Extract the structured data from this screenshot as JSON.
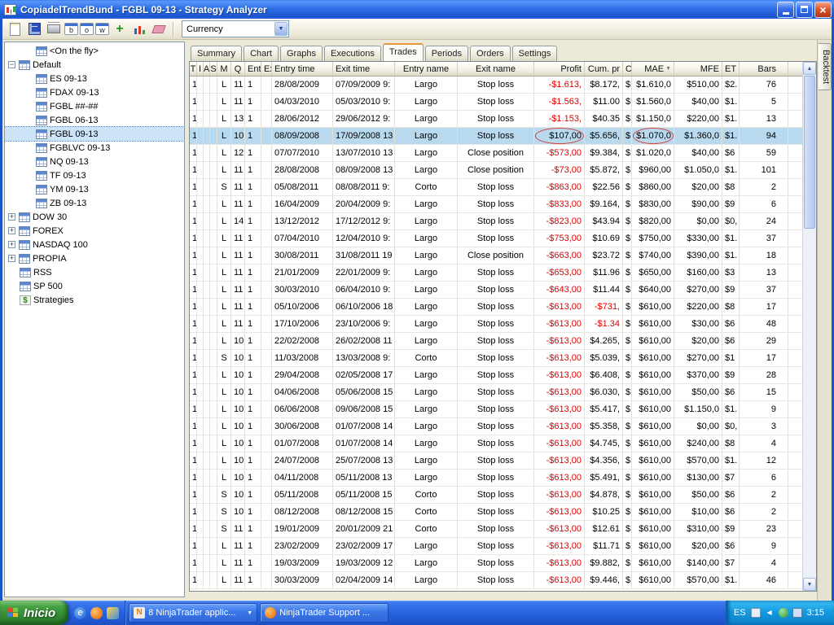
{
  "window": {
    "title": "CopiadelTrendBund - FGBL 09-13 - Strategy Analyzer"
  },
  "toolbar": {
    "combo": {
      "value": "Currency"
    },
    "buttons": [
      {
        "name": "new-document-icon"
      },
      {
        "name": "save-icon"
      },
      {
        "name": "print-icon"
      },
      {
        "name": "period-b-button",
        "label": "b"
      },
      {
        "name": "period-o-button",
        "label": "o"
      },
      {
        "name": "period-w-button",
        "label": "w"
      },
      {
        "name": "add-plus-button",
        "label": "+"
      },
      {
        "name": "chart-bars-icon"
      },
      {
        "name": "erase-icon"
      }
    ]
  },
  "sidebar": {
    "items": [
      {
        "label": "<On the fly>",
        "indent": 1,
        "icon": "grid"
      },
      {
        "label": "Default",
        "indent": 0,
        "expander": "minus",
        "icon": "grid"
      },
      {
        "label": "ES 09-13",
        "indent": 1,
        "icon": "grid"
      },
      {
        "label": "FDAX 09-13",
        "indent": 1,
        "icon": "grid"
      },
      {
        "label": "FGBL ##-##",
        "indent": 1,
        "icon": "grid"
      },
      {
        "label": "FGBL 06-13",
        "indent": 1,
        "icon": "grid"
      },
      {
        "label": "FGBL 09-13",
        "indent": 1,
        "icon": "grid",
        "selected": true
      },
      {
        "label": "FGBLVC 09-13",
        "indent": 1,
        "icon": "grid"
      },
      {
        "label": "NQ 09-13",
        "indent": 1,
        "icon": "grid"
      },
      {
        "label": "TF 09-13",
        "indent": 1,
        "icon": "grid"
      },
      {
        "label": "YM 09-13",
        "indent": 1,
        "icon": "grid"
      },
      {
        "label": "ZB 09-13",
        "indent": 1,
        "icon": "grid"
      },
      {
        "label": "DOW 30",
        "indent": 0,
        "expander": "plus",
        "icon": "grid"
      },
      {
        "label": "FOREX",
        "indent": 0,
        "expander": "plus",
        "icon": "grid"
      },
      {
        "label": "NASDAQ 100",
        "indent": 0,
        "expander": "plus",
        "icon": "grid"
      },
      {
        "label": "PROPIA",
        "indent": 0,
        "expander": "plus",
        "icon": "grid"
      },
      {
        "label": "RSS",
        "indent": 0,
        "icon": "grid"
      },
      {
        "label": "SP 500",
        "indent": 0,
        "icon": "grid"
      },
      {
        "label": "Strategies",
        "indent": 0,
        "icon": "dollar"
      }
    ]
  },
  "tabs": {
    "items": [
      "Summary",
      "Chart",
      "Graphs",
      "Executions",
      "Trades",
      "Periods",
      "Orders",
      "Settings"
    ],
    "active": "Trades"
  },
  "backtest_tab": {
    "label": "Backtest"
  },
  "trades": {
    "columns": [
      "T",
      "I",
      "A",
      "S",
      "M",
      "Q",
      "Ent",
      "Ex",
      "Entry time",
      "Exit time",
      "Entry name",
      "Exit name",
      "Profit",
      "Cum. pr",
      "C",
      "MAE",
      "MFE",
      "ET",
      "Bars"
    ],
    "sorted_by": "MAE",
    "sort_direction": "desc",
    "highlighted_row": 4,
    "annotations": {
      "circled_columns": [
        "Profit",
        "MAE"
      ],
      "circle_color": "#d04040"
    },
    "rows": [
      [
        "1",
        "",
        "",
        "",
        "L",
        "11",
        "1",
        "",
        "28/08/2009",
        "07/09/2009 9:",
        "Largo",
        "Stop loss",
        "-$1.613,",
        "$8.172,",
        "$",
        "$1.610,0",
        "$510,00",
        "$2.",
        "76"
      ],
      [
        "1",
        "",
        "",
        "",
        "L",
        "11",
        "1",
        "",
        "04/03/2010",
        "05/03/2010 9:",
        "Largo",
        "Stop loss",
        "-$1.563,",
        "$11.00",
        "$",
        "$1.560,0",
        "$40,00",
        "$1.",
        "5"
      ],
      [
        "1",
        "",
        "",
        "",
        "L",
        "13",
        "1",
        "",
        "28/06/2012",
        "29/06/2012 9:",
        "Largo",
        "Stop loss",
        "-$1.153,",
        "$40.35",
        "$",
        "$1.150,0",
        "$220,00",
        "$1.",
        "13"
      ],
      [
        "1",
        "",
        "",
        "",
        "L",
        "10",
        "1",
        "",
        "08/09/2008",
        "17/09/2008 13",
        "Largo",
        "Stop loss",
        "$107,00",
        "$5.656,",
        "$",
        "$1.070,0",
        "$1.360,0",
        "$1.",
        "94"
      ],
      [
        "1",
        "",
        "",
        "",
        "L",
        "12",
        "1",
        "",
        "07/07/2010",
        "13/07/2010 13",
        "Largo",
        "Close position",
        "-$573,00",
        "$9.384,",
        "$",
        "$1.020,0",
        "$40,00",
        "$6",
        "59"
      ],
      [
        "1",
        "",
        "",
        "",
        "L",
        "11",
        "1",
        "",
        "28/08/2008",
        "08/09/2008 13",
        "Largo",
        "Close position",
        "-$73,00",
        "$5.872,",
        "$",
        "$960,00",
        "$1.050,0",
        "$1.",
        "101"
      ],
      [
        "1",
        "",
        "",
        "",
        "S",
        "11",
        "1",
        "",
        "05/08/2011",
        "08/08/2011 9:",
        "Corto",
        "Stop loss",
        "-$863,00",
        "$22.56",
        "$",
        "$860,00",
        "$20,00",
        "$8",
        "2"
      ],
      [
        "1",
        "",
        "",
        "",
        "L",
        "11",
        "1",
        "",
        "16/04/2009",
        "20/04/2009 9:",
        "Largo",
        "Stop loss",
        "-$833,00",
        "$9.164,",
        "$",
        "$830,00",
        "$90,00",
        "$9",
        "6"
      ],
      [
        "1",
        "",
        "",
        "",
        "L",
        "14",
        "1",
        "",
        "13/12/2012",
        "17/12/2012 9:",
        "Largo",
        "Stop loss",
        "-$823,00",
        "$43.94",
        "$",
        "$820,00",
        "$0,00",
        "$0,",
        "24"
      ],
      [
        "1",
        "",
        "",
        "",
        "L",
        "11",
        "1",
        "",
        "07/04/2010",
        "12/04/2010 9:",
        "Largo",
        "Stop loss",
        "-$753,00",
        "$10.69",
        "$",
        "$750,00",
        "$330,00",
        "$1.",
        "37"
      ],
      [
        "1",
        "",
        "",
        "",
        "L",
        "11",
        "1",
        "",
        "30/08/2011",
        "31/08/2011 19",
        "Largo",
        "Close position",
        "-$663,00",
        "$23.72",
        "$",
        "$740,00",
        "$390,00",
        "$1.",
        "18"
      ],
      [
        "1",
        "",
        "",
        "",
        "L",
        "11",
        "1",
        "",
        "21/01/2009",
        "22/01/2009 9:",
        "Largo",
        "Stop loss",
        "-$653,00",
        "$11.96",
        "$",
        "$650,00",
        "$160,00",
        "$3",
        "13"
      ],
      [
        "1",
        "",
        "",
        "",
        "L",
        "11",
        "1",
        "",
        "30/03/2010",
        "06/04/2010 9:",
        "Largo",
        "Stop loss",
        "-$643,00",
        "$11.44",
        "$",
        "$640,00",
        "$270,00",
        "$9",
        "37"
      ],
      [
        "1",
        "",
        "",
        "",
        "L",
        "11",
        "1",
        "",
        "05/10/2006",
        "06/10/2006 18",
        "Largo",
        "Stop loss",
        "-$613,00",
        "-$731,",
        "$",
        "$610,00",
        "$220,00",
        "$8",
        "17"
      ],
      [
        "1",
        "",
        "",
        "",
        "L",
        "11",
        "1",
        "",
        "17/10/2006",
        "23/10/2006 9:",
        "Largo",
        "Stop loss",
        "-$613,00",
        "-$1.34",
        "$",
        "$610,00",
        "$30,00",
        "$6",
        "48"
      ],
      [
        "1",
        "",
        "",
        "",
        "L",
        "10",
        "1",
        "",
        "22/02/2008",
        "26/02/2008 11",
        "Largo",
        "Stop loss",
        "-$613,00",
        "$4.265,",
        "$",
        "$610,00",
        "$20,00",
        "$6",
        "29"
      ],
      [
        "1",
        "",
        "",
        "",
        "S",
        "10",
        "1",
        "",
        "11/03/2008",
        "13/03/2008 9:",
        "Corto",
        "Stop loss",
        "-$613,00",
        "$5.039,",
        "$",
        "$610,00",
        "$270,00",
        "$1",
        "17"
      ],
      [
        "1",
        "",
        "",
        "",
        "L",
        "10",
        "1",
        "",
        "29/04/2008",
        "02/05/2008 17",
        "Largo",
        "Stop loss",
        "-$613,00",
        "$6.408,",
        "$",
        "$610,00",
        "$370,00",
        "$9",
        "28"
      ],
      [
        "1",
        "",
        "",
        "",
        "L",
        "10",
        "1",
        "",
        "04/06/2008",
        "05/06/2008 15",
        "Largo",
        "Stop loss",
        "-$613,00",
        "$6.030,",
        "$",
        "$610,00",
        "$50,00",
        "$6",
        "15"
      ],
      [
        "1",
        "",
        "",
        "",
        "L",
        "10",
        "1",
        "",
        "06/06/2008",
        "09/06/2008 15",
        "Largo",
        "Stop loss",
        "-$613,00",
        "$5.417,",
        "$",
        "$610,00",
        "$1.150,0",
        "$1.",
        "9"
      ],
      [
        "1",
        "",
        "",
        "",
        "L",
        "10",
        "1",
        "",
        "30/06/2008",
        "01/07/2008 14",
        "Largo",
        "Stop loss",
        "-$613,00",
        "$5.358,",
        "$",
        "$610,00",
        "$0,00",
        "$0,",
        "3"
      ],
      [
        "1",
        "",
        "",
        "",
        "L",
        "10",
        "1",
        "",
        "01/07/2008",
        "01/07/2008 14",
        "Largo",
        "Stop loss",
        "-$613,00",
        "$4.745,",
        "$",
        "$610,00",
        "$240,00",
        "$8",
        "4"
      ],
      [
        "1",
        "",
        "",
        "",
        "L",
        "10",
        "1",
        "",
        "24/07/2008",
        "25/07/2008 13",
        "Largo",
        "Stop loss",
        "-$613,00",
        "$4.356,",
        "$",
        "$610,00",
        "$570,00",
        "$1.",
        "12"
      ],
      [
        "1",
        "",
        "",
        "",
        "L",
        "10",
        "1",
        "",
        "04/11/2008",
        "05/11/2008 13",
        "Largo",
        "Stop loss",
        "-$613,00",
        "$5.491,",
        "$",
        "$610,00",
        "$130,00",
        "$7",
        "6"
      ],
      [
        "1",
        "",
        "",
        "",
        "S",
        "10",
        "1",
        "",
        "05/11/2008",
        "05/11/2008 15",
        "Corto",
        "Stop loss",
        "-$613,00",
        "$4.878,",
        "$",
        "$610,00",
        "$50,00",
        "$6",
        "2"
      ],
      [
        "1",
        "",
        "",
        "",
        "S",
        "10",
        "1",
        "",
        "08/12/2008",
        "08/12/2008 15",
        "Corto",
        "Stop loss",
        "-$613,00",
        "$10.25",
        "$",
        "$610,00",
        "$10,00",
        "$6",
        "2"
      ],
      [
        "1",
        "",
        "",
        "",
        "S",
        "11",
        "1",
        "",
        "19/01/2009",
        "20/01/2009 21",
        "Corto",
        "Stop loss",
        "-$613,00",
        "$12.61",
        "$",
        "$610,00",
        "$310,00",
        "$9",
        "23"
      ],
      [
        "1",
        "",
        "",
        "",
        "L",
        "11",
        "1",
        "",
        "23/02/2009",
        "23/02/2009 17",
        "Largo",
        "Stop loss",
        "-$613,00",
        "$11.71",
        "$",
        "$610,00",
        "$20,00",
        "$6",
        "9"
      ],
      [
        "1",
        "",
        "",
        "",
        "L",
        "11",
        "1",
        "",
        "19/03/2009",
        "19/03/2009 12",
        "Largo",
        "Stop loss",
        "-$613,00",
        "$9.882,",
        "$",
        "$610,00",
        "$140,00",
        "$7",
        "4"
      ],
      [
        "1",
        "",
        "",
        "",
        "L",
        "11",
        "1",
        "",
        "30/03/2009",
        "02/04/2009 14",
        "Largo",
        "Stop loss",
        "-$613,00",
        "$9.446,",
        "$",
        "$610,00",
        "$570,00",
        "$1.",
        "46"
      ]
    ]
  },
  "taskbar": {
    "start_label": "Inicio",
    "quick_launch": [
      "ie-icon",
      "firefox-icon",
      "explorer-icon"
    ],
    "tasks": [
      {
        "label": "8 NinjaTrader applic...",
        "icon": "ninjatrader-icon",
        "has_dropdown": true
      },
      {
        "label": "NinjaTrader Support ...",
        "icon": "firefox-icon"
      }
    ],
    "tray": {
      "lang": "ES",
      "icons": [
        "keyboard-icon",
        "hide-chevron-icon",
        "shield-icon",
        "monitor-icon"
      ],
      "time": "3:15"
    }
  }
}
